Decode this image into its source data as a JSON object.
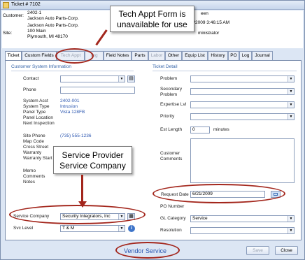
{
  "window": {
    "title": "Ticket # 7102"
  },
  "header": {
    "customer_label": "Customer:",
    "customer_acct": "2402-1",
    "customer_name": "Jackson Auto Parts-Corp.",
    "site_label": "Site:",
    "site_name": "Jackson Auto Parts-Corp.",
    "site_street": "100 Main",
    "site_city": "Plymouth, MI  48170",
    "right_1": "een",
    "right_2": "21/2009 3:46:15 AM",
    "right_3": "ministrator"
  },
  "tabs": [
    {
      "label": "Ticket",
      "state": "active"
    },
    {
      "label": "Custom Fields",
      "state": "normal"
    },
    {
      "label": "Tech Appt",
      "state": "disabled"
    },
    {
      "label": "ling",
      "state": "disabled"
    },
    {
      "label": "Field Notes",
      "state": "normal"
    },
    {
      "label": "Parts",
      "state": "normal"
    },
    {
      "label": "Labor",
      "state": "disabled"
    },
    {
      "label": "Other",
      "state": "normal"
    },
    {
      "label": "Equip List",
      "state": "normal"
    },
    {
      "label": "History",
      "state": "normal"
    },
    {
      "label": "PO",
      "state": "normal"
    },
    {
      "label": "Log",
      "state": "normal"
    },
    {
      "label": "Journal",
      "state": "normal"
    }
  ],
  "left": {
    "section_title": "Customer System Information",
    "contact_label": "Contact",
    "phone_label": "Phone",
    "system_acct_label": "System Acct",
    "system_acct_value": "2402-001",
    "system_type_label": "System Type",
    "system_type_value": "Intrusion",
    "panel_type_label": "Panel Type",
    "panel_type_value": "Vista 128FB",
    "panel_location_label": "Panel Location",
    "next_inspection_label": "Next Inspection",
    "site_phone_label": "Site Phone",
    "site_phone_value": "(735) 555-1236",
    "map_code_label": "Map Code",
    "cross_street_label": "Cross Street",
    "warranty_label": "Warranty",
    "warranty_start_label": "Warranty Start",
    "memo_label": "Memo",
    "comments_label": "Comments",
    "notes_label": "Notes",
    "service_company_label": "Service Company",
    "service_company_value": "Security Integrators, Inc",
    "svc_level_label": "Svc Level",
    "svc_level_value": "T & M"
  },
  "right": {
    "section_title": "Ticket Detail",
    "problem_label": "Problem",
    "secondary_problem_label": "Secondary Problem",
    "expertise_label": "Expertise Lvl",
    "priority_label": "Priority",
    "est_length_label": "Est Length",
    "est_length_value": "0",
    "est_length_unit": "minutes",
    "customer_comments_label": "Customer Comments",
    "request_date_label": "Request Date",
    "request_date_value": "6/21/2009",
    "po_number_label": "PO Number",
    "gl_category_label": "GL Category",
    "gl_category_value": "Service",
    "resolution_label": "Resolution"
  },
  "footer": {
    "vendor_service_label": "Vendor Service",
    "save_label": "Save",
    "close_label": "Close"
  },
  "callouts": {
    "tech_appt": "Tech Appt Form is unavailable for use",
    "service_provider": "Service Provider Service Company"
  },
  "colors": {
    "annotation": "#a3261c",
    "link": "#2b56b0",
    "section": "#3564a8"
  }
}
